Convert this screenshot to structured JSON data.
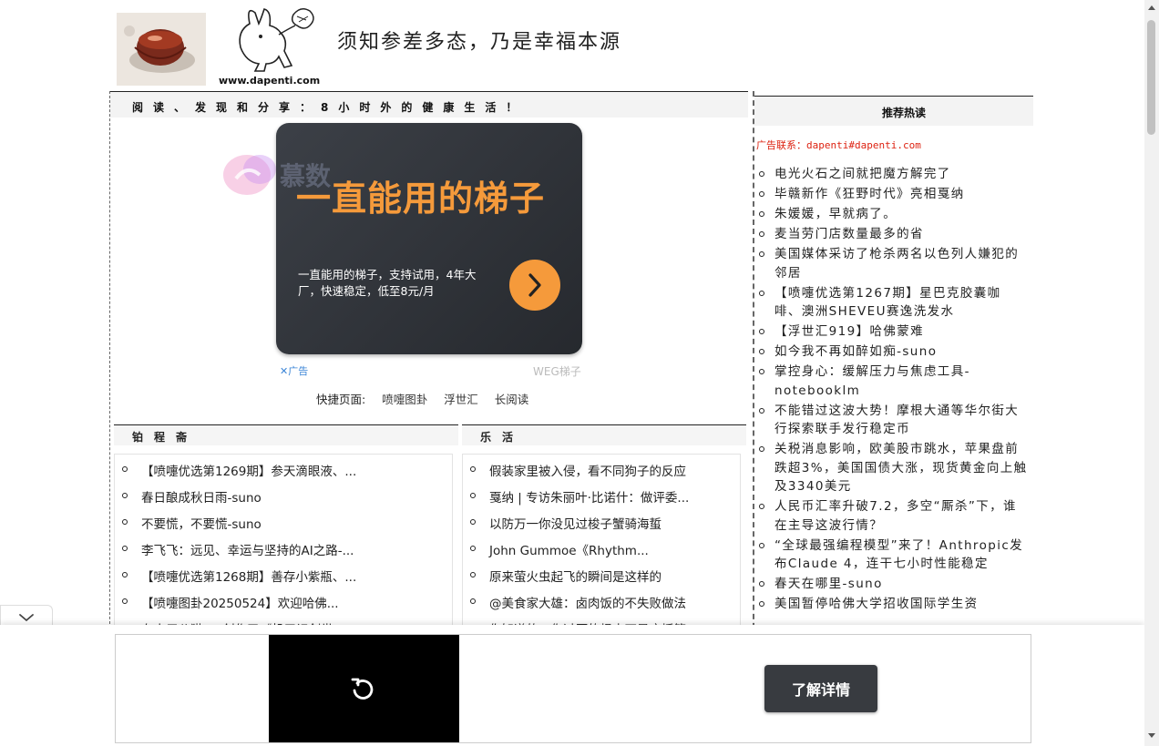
{
  "header": {
    "site_url": "www.dapenti.com",
    "slogan": "须知参差多态，乃是幸福本源"
  },
  "main": {
    "tagline": "阅读、发现和分享：8小时外的健康生活！",
    "ad": {
      "headline": "一直能用的梯子",
      "subtext": "一直能用的梯子，支持试用，4年大厂，快速稳定，低至8元/月",
      "watermark": "慕数",
      "label": "广告",
      "close_glyph": "✕",
      "brand": "WEG梯子"
    },
    "quicklinks": {
      "label": "快捷页面:",
      "links": [
        "喷嚏图卦",
        "浮世汇",
        "长阅读"
      ]
    },
    "col_left": {
      "title": "铂程斋",
      "items": [
        "【喷嚏优选第1269期】参天滴眼液、...",
        "春日酿成秋日雨-suno",
        "不要慌，不要慌-suno",
        "李飞飞：远见、幸运与坚持的AI之路-...",
        "【喷嚏优选第1268期】善存小紫瓶、...",
        "【喷嚏图卦20250524】欢迎哈佛...",
        "在人用公猫fo3创作了《机三记剑世..."
      ]
    },
    "col_right": {
      "title": "乐活",
      "items": [
        "假装家里被入侵，看不同狗子的反应",
        "戛纳 | 专访朱丽叶·比诺什：做评委...",
        "以防万一你没见过梭子蟹骑海蜇",
        "John Gummoe《Rhythm...",
        "原来萤火虫起飞的瞬间是这样的",
        "@美食家大雄：卤肉饭的不失败做法",
        "你知道的，你过压的根本不是床摇篮..."
      ]
    }
  },
  "sidebar": {
    "title": "推荐热读",
    "ad_contact": "广告联系：dapenti#dapenti.com",
    "items": [
      "电光火石之间就把魔方解完了",
      "毕赣新作《狂野时代》亮相戛纳",
      "朱媛媛，早就病了。",
      "麦当劳门店数量最多的省",
      "美国媒体采访了枪杀两名以色列人嫌犯的邻居",
      "【喷嚏优选第1267期】星巴克胶囊咖啡、澳洲SHEVEU赛逸洗发水",
      "【浮世汇919】哈佛蒙难",
      "如今我不再如醉如痴-suno",
      "掌控身心：缓解压力与焦虑工具-notebooklm",
      "不能错过这波大势！摩根大通等华尔街大行探索联手发行稳定币",
      "关税消息影响，欧美股市跳水，苹果盘前跌超3%，美国国债大涨，现货黄金向上触及3340美元",
      "人民币汇率升破7.2，多空“厮杀”下，谁在主导这波行情？",
      "“全球最强编程模型”来了！Anthropic发布Claude 4，连干七小时性能稳定",
      "春天在哪里-suno",
      "美国暂停哈佛大学招收国际学生资"
    ]
  },
  "bottom_ad": {
    "button_label": "了解详情"
  }
}
